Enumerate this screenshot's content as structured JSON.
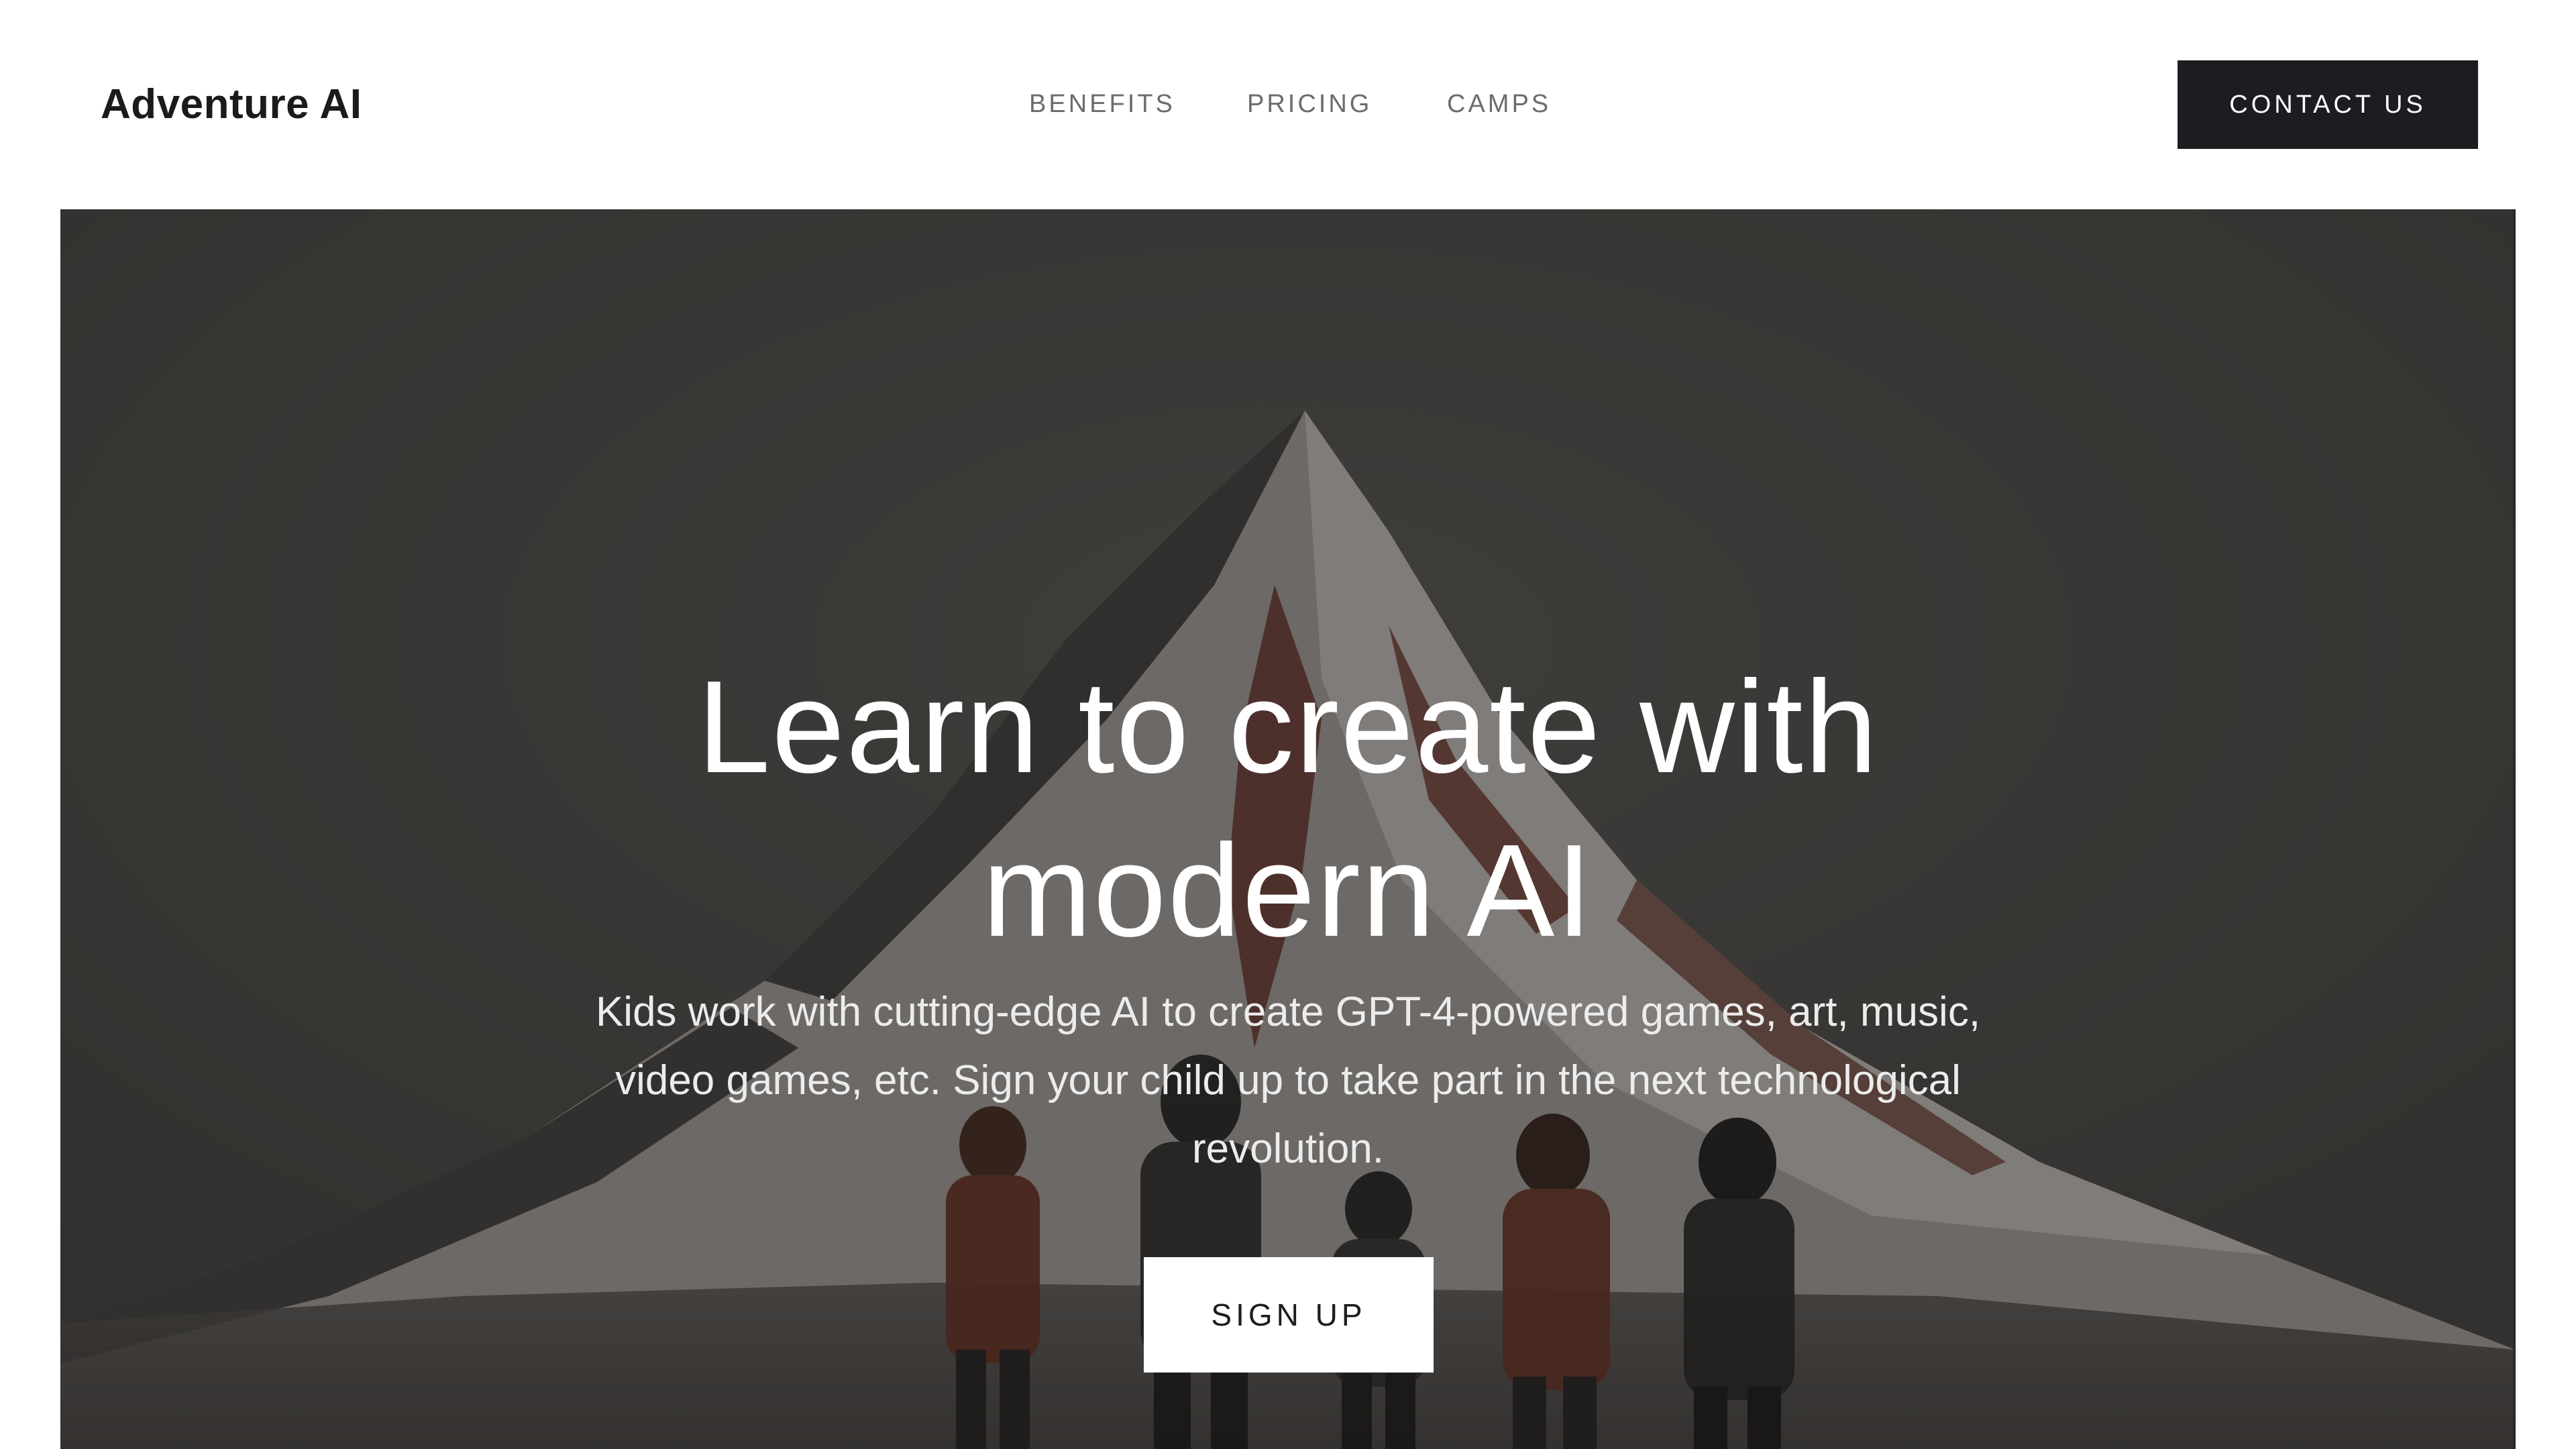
{
  "header": {
    "brand": "Adventure AI",
    "nav_links": [
      "BENEFITS",
      "PRICING",
      "CAMPS"
    ],
    "contact_label": "CONTACT US"
  },
  "hero": {
    "title": "Learn to create with modern AI",
    "subtitle": "Kids work with cutting-edge AI to create GPT-4-powered games, art, music, video games, etc. Sign your child up to take part in the next technological revolution.",
    "cta_label": "SIGN UP",
    "background_image": "mountain-with-children-illustration"
  },
  "colors": {
    "header_bg": "#ffffff",
    "brand_text": "#1b1b1b",
    "nav_text": "#6c6c6c",
    "contact_button_bg": "#1c1d20",
    "hero_bg": "#44423f",
    "hero_text": "#ffffff",
    "signup_button_bg": "#ffffff"
  }
}
